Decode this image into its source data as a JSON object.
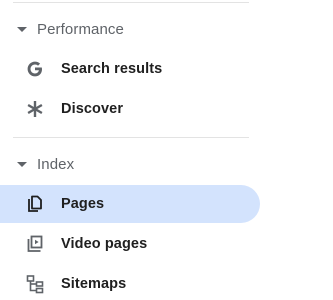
{
  "nav": {
    "sections": [
      {
        "label": "Performance",
        "items": [
          {
            "label": "Search results",
            "icon": "google-g-icon"
          },
          {
            "label": "Discover",
            "icon": "asterisk-icon"
          }
        ]
      },
      {
        "label": "Index",
        "items": [
          {
            "label": "Pages",
            "icon": "pages-icon",
            "active": true
          },
          {
            "label": "Video pages",
            "icon": "video-pages-icon"
          },
          {
            "label": "Sitemaps",
            "icon": "sitemap-icon"
          }
        ]
      }
    ]
  },
  "colors": {
    "active_background": "#d3e3fd",
    "section_text": "#5f6368",
    "item_text": "#1f1f1f",
    "divider": "#e3e3e3"
  }
}
